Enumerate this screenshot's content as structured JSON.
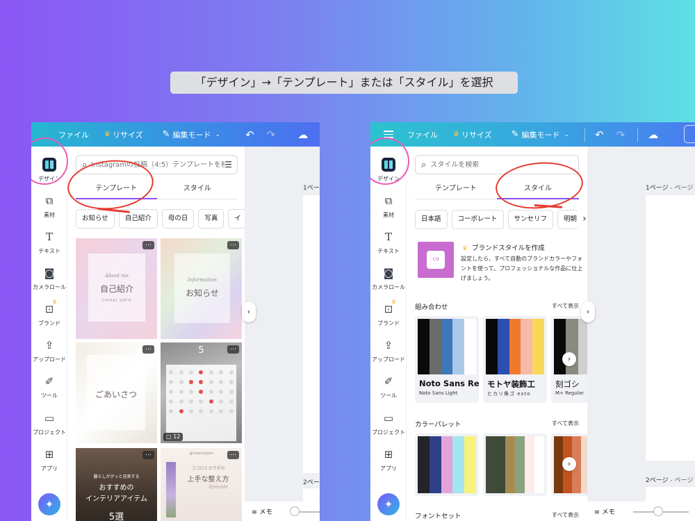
{
  "caption": "「デザイン」→「テンプレート」または「スタイル」を選択",
  "topbar": {
    "file": "ファイル",
    "resize": "リサイズ",
    "edit_mode": "編集モード"
  },
  "sidebar": {
    "items": [
      {
        "label": "デザイン",
        "icon": "design-icon"
      },
      {
        "label": "素材",
        "icon": "elements-icon"
      },
      {
        "label": "テキスト",
        "icon": "text-icon"
      },
      {
        "label": "カメラロール",
        "icon": "camera-icon"
      },
      {
        "label": "ブランド",
        "icon": "brand-icon"
      },
      {
        "label": "アップロード",
        "icon": "upload-icon"
      },
      {
        "label": "ツール",
        "icon": "tools-icon"
      },
      {
        "label": "プロジェクト",
        "icon": "folder-icon"
      },
      {
        "label": "アプリ",
        "icon": "apps-icon"
      }
    ]
  },
  "left_panel": {
    "search_placeholder": "Instagramの投稿（4:5）テンプレートを検",
    "tabs": [
      "テンプレート",
      "スタイル"
    ],
    "active_tab": 0,
    "chips": [
      "お知らせ",
      "自己紹介",
      "母の日",
      "写真",
      "イ"
    ],
    "templates": [
      {
        "small": "About me",
        "big": "自己紹介",
        "tiny": "CHIAKI SATO"
      },
      {
        "small": "Information",
        "big": "お知らせ"
      },
      {
        "big": "ごあいさつ"
      },
      {
        "num": "5",
        "pages": "12"
      },
      {
        "line1": "暮らしがグッと充実する",
        "line2": "おすすめの",
        "line3": "インテリアアイテム",
        "line4": "5選"
      },
      {
        "line0": "@interiorpost",
        "line1": "ココロとカラダの",
        "line2": "上手な整え方",
        "line3": "Episode"
      }
    ],
    "canvas_page1": "1ペー",
    "canvas_page2": "2ペー"
  },
  "right_panel": {
    "search_placeholder": "スタイルを検索",
    "tabs": [
      "テンプレート",
      "スタイル"
    ],
    "active_tab": 1,
    "chips": [
      "日本語",
      "コーポレート",
      "サンセリフ",
      "明朝"
    ],
    "brand": {
      "title": "ブランドスタイルを作成",
      "desc": "設定したら、すべて自動のブランドカラーやフォントを使って、プロフェッショナルな作品に仕上げましょう。",
      "thumb_text": "co"
    },
    "combos_title": "組み合わせ",
    "palettes_title": "カラーパレット",
    "fontset_title": "フォントセット",
    "show_all": "すべて表示",
    "combos": [
      {
        "big": "Noto Sans Re",
        "small": "Noto Sans Light",
        "colors": [
          "#0a0a0a",
          "#6b6b6b",
          "#3d78b8",
          "#a9c8ea",
          "#ffffff"
        ]
      },
      {
        "big": "モトヤ装飾工",
        "small": "ヒカリ角ゴ exto",
        "colors": [
          "#0a0a0a",
          "#2b4fb0",
          "#f07a2c",
          "#f7b9a8",
          "#f8d85a"
        ]
      },
      {
        "big": "刻ゴシ",
        "small": "M+ Regular",
        "colors": [
          "#0a0a0a",
          "#8a8a80",
          "#cfcfcf"
        ]
      }
    ],
    "palettes": [
      {
        "colors": [
          "#222428",
          "#2e3f8a",
          "#e4a3d8",
          "#a3e6f0",
          "#f6f27a"
        ]
      },
      {
        "colors": [
          "#424a3c",
          "#3e4a35",
          "#a78a50",
          "#8aa27c",
          "#fdeaea",
          "#ffffff"
        ]
      },
      {
        "colors": [
          "#7a3a10",
          "#c2521e",
          "#d97d58",
          "#f1d9cc"
        ]
      }
    ],
    "canvas_page1": "1ページ",
    "canvas_page1_suffix": " - ページ",
    "canvas_page2": "2ページ",
    "canvas_page2_suffix": " - ページ"
  },
  "bottombar": {
    "memo": "メモ",
    "zoom_left": 0.07,
    "zoom_right": 0.45
  }
}
